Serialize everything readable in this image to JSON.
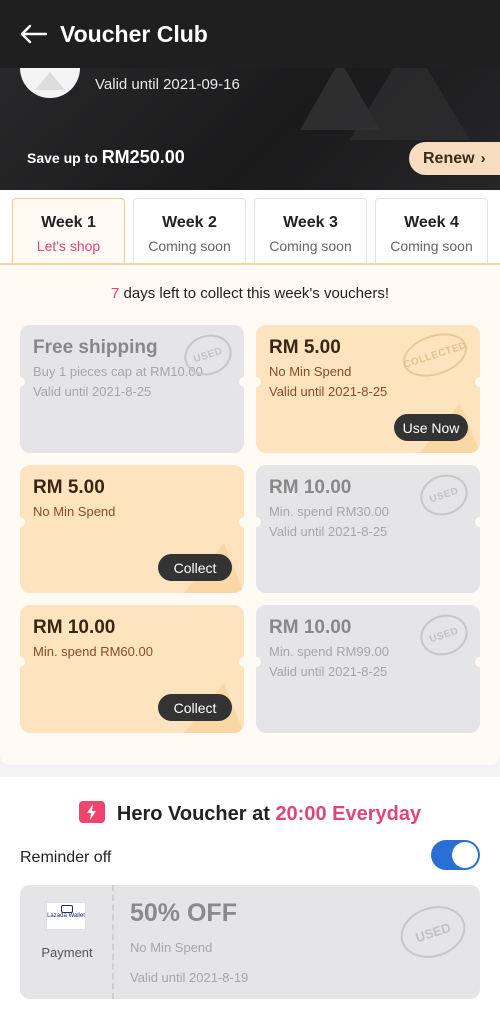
{
  "header": {
    "title": "Voucher Club",
    "valid_until": "Valid until 2021-09-16",
    "save_prefix": "Save up to",
    "save_amount": "RM250.00",
    "renew_label": "Renew"
  },
  "weeks": [
    {
      "label": "Week 1",
      "status": "Let's shop",
      "active": true
    },
    {
      "label": "Week 2",
      "status": "Coming soon",
      "active": false
    },
    {
      "label": "Week 3",
      "status": "Coming soon",
      "active": false
    },
    {
      "label": "Week 4",
      "status": "Coming soon",
      "active": false
    }
  ],
  "days_left": {
    "count": "7",
    "text": "days left to collect this week's vouchers!"
  },
  "vouchers": [
    {
      "title": "Free shipping",
      "line1": "Buy 1 pieces cap at RM10.00",
      "line2": "Valid until 2021-8-25",
      "state": "USED",
      "style": "grey"
    },
    {
      "title": "RM 5.00",
      "line1": "No Min Spend",
      "line2": "Valid until 2021-8-25",
      "state": "COLLECTED",
      "button": "Use Now",
      "style": "orange"
    },
    {
      "title": "RM 5.00",
      "line1": "No Min Spend",
      "line2": "",
      "button": "Collect",
      "style": "orange"
    },
    {
      "title": "RM 10.00",
      "line1": "Min. spend RM30.00",
      "line2": "Valid until 2021-8-25",
      "state": "USED",
      "style": "grey"
    },
    {
      "title": "RM 10.00",
      "line1": "Min. spend RM60.00",
      "line2": "",
      "button": "Collect",
      "style": "orange"
    },
    {
      "title": "RM 10.00",
      "line1": "Min. spend RM99.00",
      "line2": "Valid until 2021-8-25",
      "state": "USED",
      "style": "grey"
    }
  ],
  "hero": {
    "title_prefix": "Hero Voucher at",
    "title_time": "20:00 Everyday",
    "reminder_label": "Reminder off",
    "reminder_on": true,
    "voucher": {
      "logo_text": "Lazada Wallet",
      "method": "Payment",
      "title": "50% OFF",
      "line1": "No Min Spend",
      "line2": "Valid until 2021-8-19",
      "state": "USED"
    }
  },
  "colors": {
    "accent": "#e0457b",
    "toggle": "#2a6fd6",
    "renew": "#f7dcc0",
    "voucher_orange": "#fde4be",
    "voucher_grey": "#e5e5e7"
  }
}
